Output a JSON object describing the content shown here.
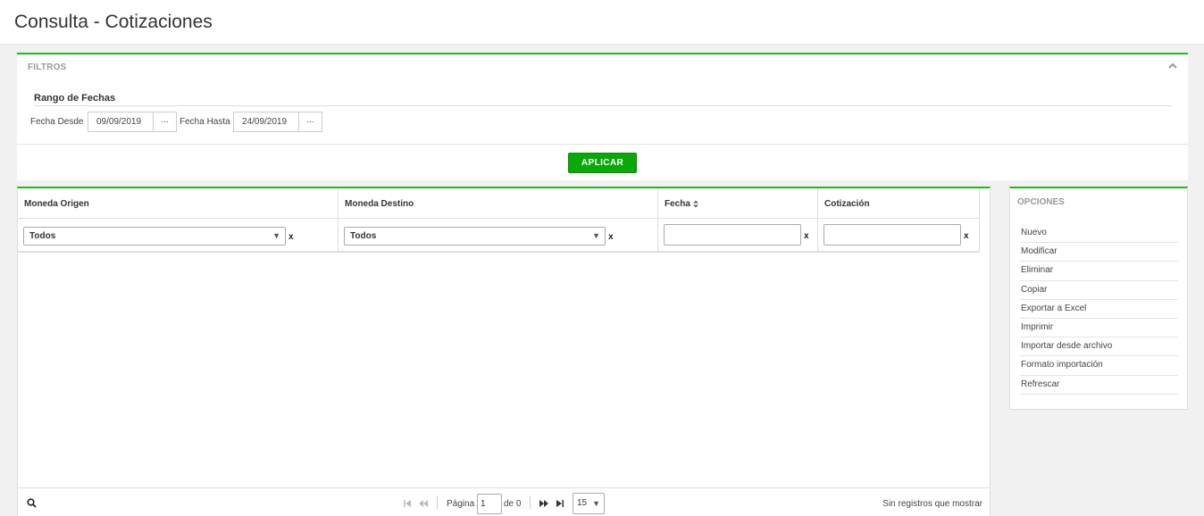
{
  "page": {
    "title": "Consulta - Cotizaciones"
  },
  "filters": {
    "title": "FILTROS",
    "range_title": "Rango de Fechas",
    "from_label": "Fecha Desde",
    "from_value": "09/09/2019",
    "to_label": "Fecha Hasta",
    "to_value": "24/09/2019",
    "picker_label": "...",
    "apply_label": "APLICAR"
  },
  "grid": {
    "columns": [
      {
        "label": "Moneda Origen"
      },
      {
        "label": "Moneda Destino"
      },
      {
        "label": "Fecha"
      },
      {
        "label": "Cotización"
      }
    ],
    "filters": {
      "origen_value": "Todos",
      "destino_value": "Todos",
      "fecha_value": "",
      "cotizacion_value": "",
      "clear_label": "x"
    },
    "rows": [],
    "footer": {
      "page_label": "Página",
      "page_value": "1",
      "of_label": "de 0",
      "page_size": "15",
      "status": "Sin registros que mostrar"
    }
  },
  "options": {
    "title": "OPCIONES",
    "items": [
      "Nuevo",
      "Modificar",
      "Eliminar",
      "Copiar",
      "Exportar a Excel",
      "Imprimir",
      "Importar desde archivo",
      "Formato importación",
      "Refrescar"
    ]
  },
  "colors": {
    "accent": "#22b722",
    "apply_button": "#0aa90a"
  },
  "icons": {
    "collapse": "chevron-up-icon",
    "sort": "sort-icon",
    "search": "search-icon",
    "first": "first-page-icon",
    "prev": "prev-page-icon",
    "next": "next-page-icon",
    "last": "last-page-icon"
  }
}
